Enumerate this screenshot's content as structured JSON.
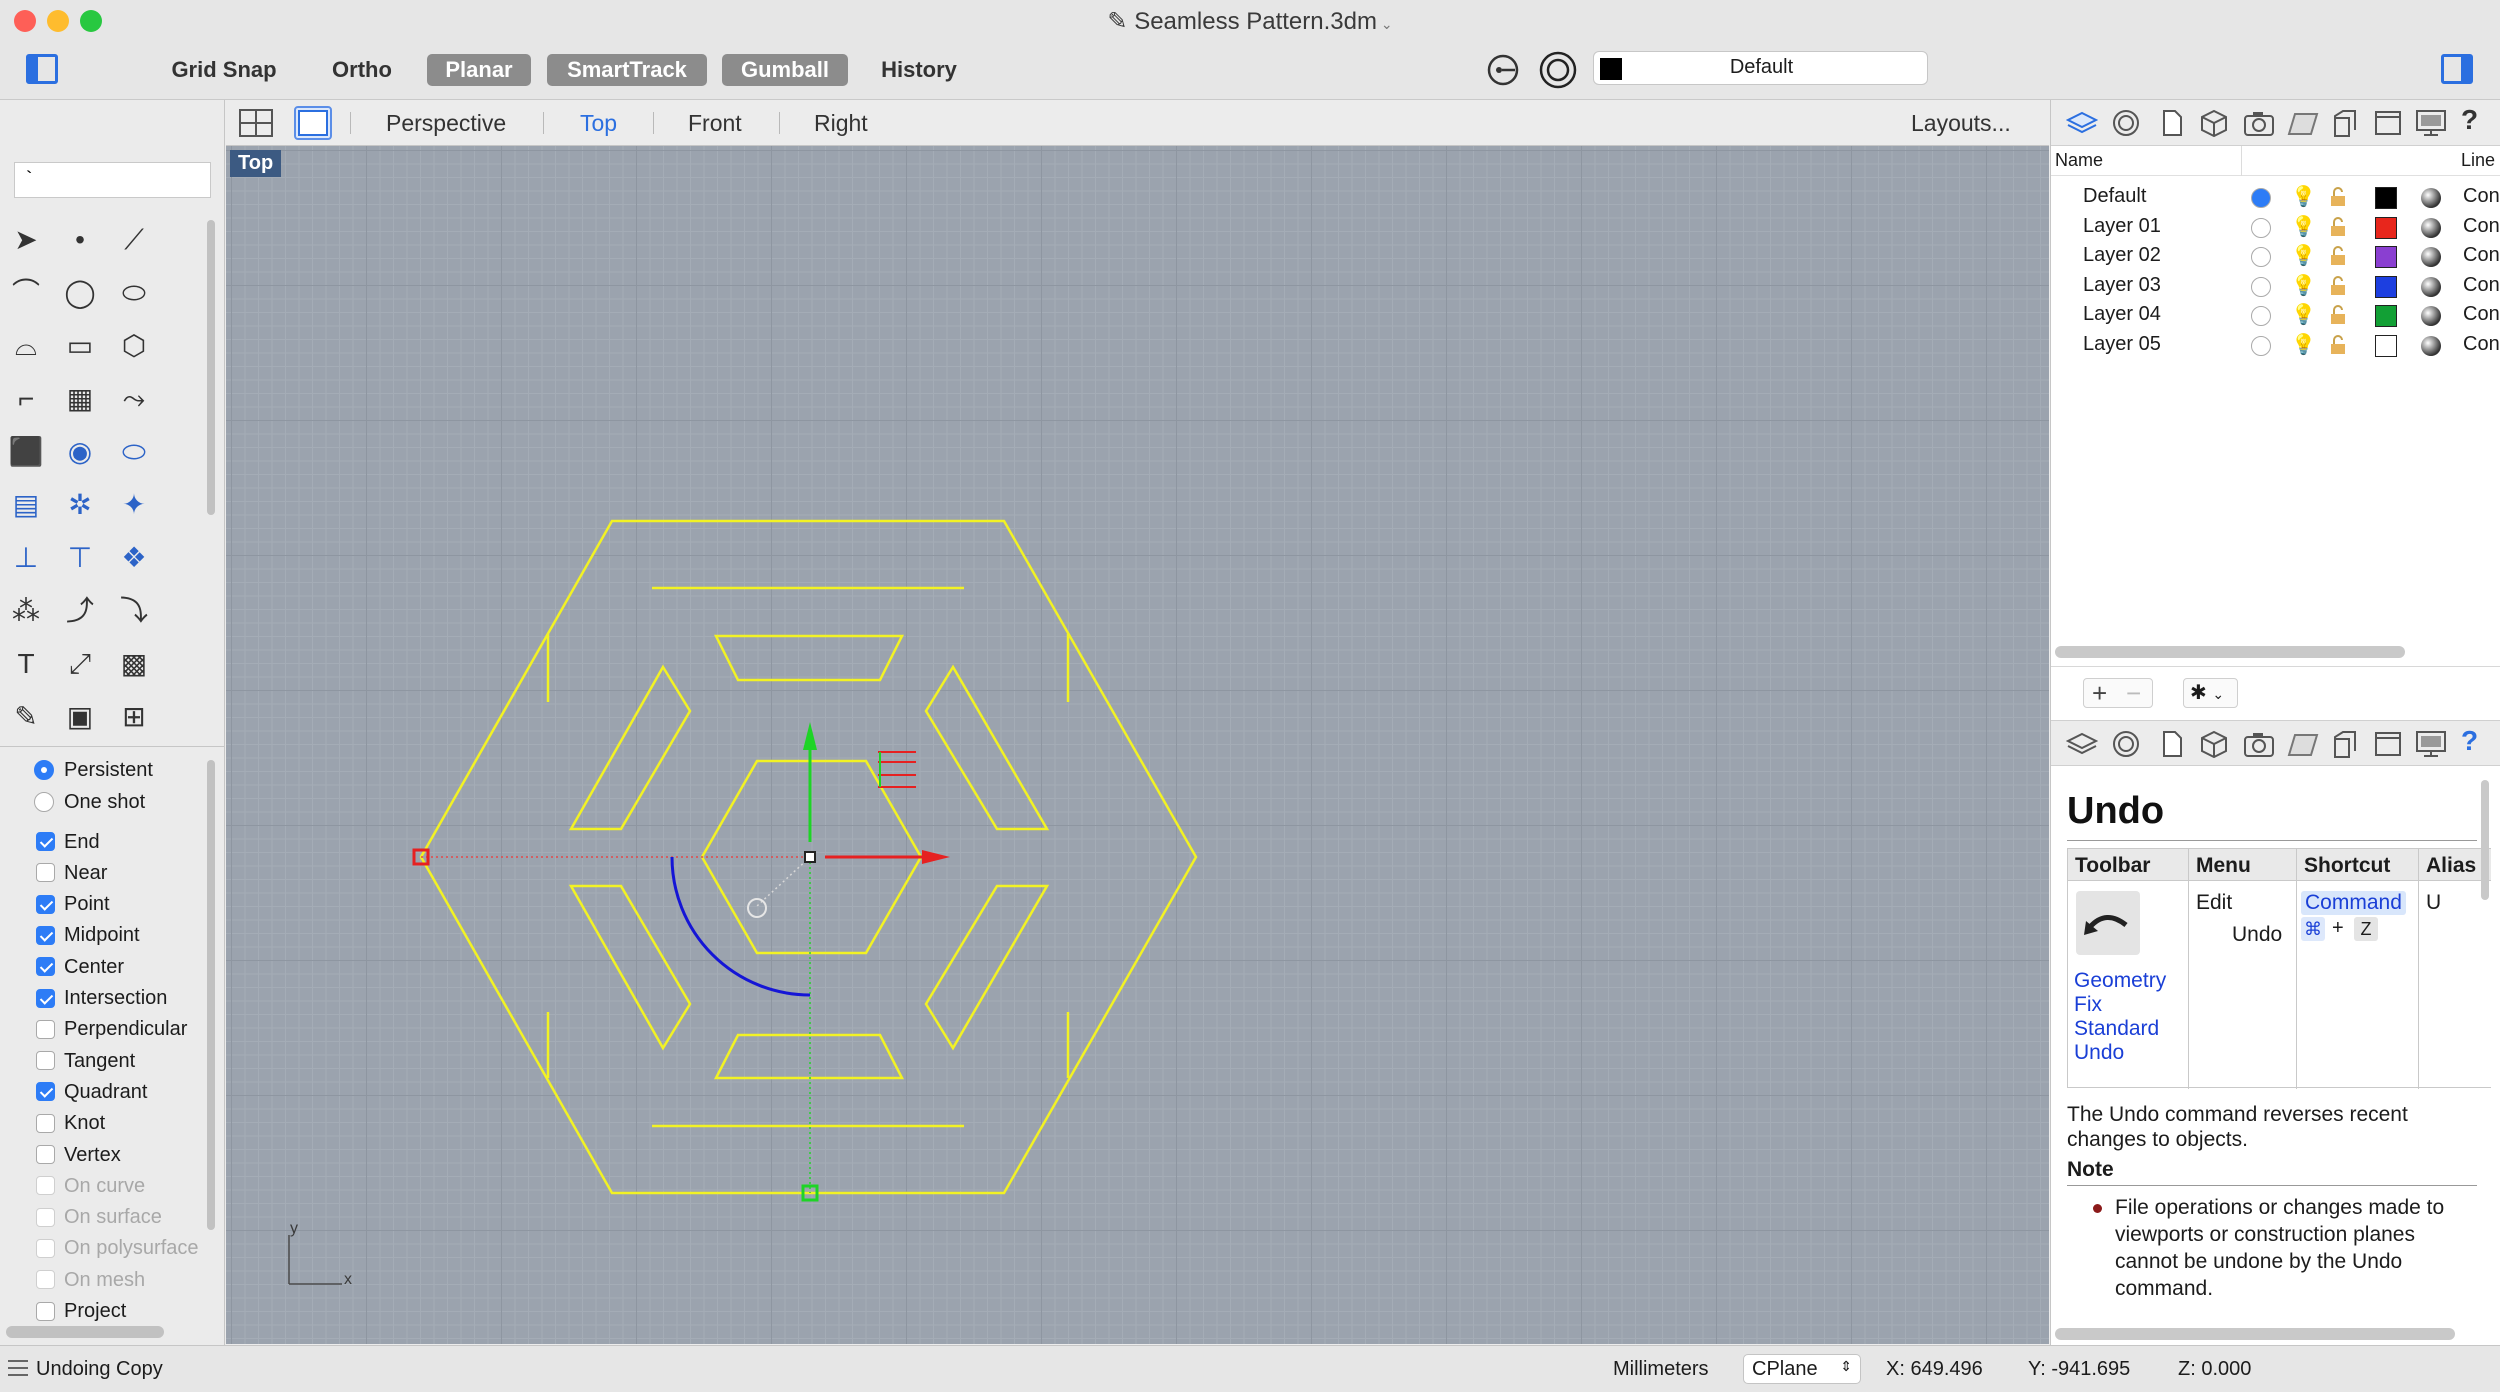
{
  "window": {
    "title": "Seamless Pattern.3dm"
  },
  "toolbar": {
    "buttons": [
      {
        "label": "Grid Snap",
        "on": false
      },
      {
        "label": "Ortho",
        "on": false
      },
      {
        "label": "Planar",
        "on": true
      },
      {
        "label": "SmartTrack",
        "on": true
      },
      {
        "label": "Gumball",
        "on": true
      },
      {
        "label": "History",
        "on": false
      }
    ],
    "layer_select": "Default"
  },
  "command": {
    "input_value": "`"
  },
  "osnap": {
    "modes": [
      "Persistent",
      "One shot"
    ],
    "selected_mode": "Persistent",
    "items": [
      {
        "label": "End",
        "checked": true,
        "enabled": true
      },
      {
        "label": "Near",
        "checked": false,
        "enabled": true
      },
      {
        "label": "Point",
        "checked": true,
        "enabled": true
      },
      {
        "label": "Midpoint",
        "checked": true,
        "enabled": true
      },
      {
        "label": "Center",
        "checked": true,
        "enabled": true
      },
      {
        "label": "Intersection",
        "checked": true,
        "enabled": true
      },
      {
        "label": "Perpendicular",
        "checked": false,
        "enabled": true
      },
      {
        "label": "Tangent",
        "checked": false,
        "enabled": true
      },
      {
        "label": "Quadrant",
        "checked": true,
        "enabled": true
      },
      {
        "label": "Knot",
        "checked": false,
        "enabled": true
      },
      {
        "label": "Vertex",
        "checked": false,
        "enabled": true
      },
      {
        "label": "On curve",
        "checked": false,
        "enabled": false
      },
      {
        "label": "On surface",
        "checked": false,
        "enabled": false
      },
      {
        "label": "On polysurface",
        "checked": false,
        "enabled": false
      },
      {
        "label": "On mesh",
        "checked": false,
        "enabled": false
      },
      {
        "label": "Project",
        "checked": false,
        "enabled": true
      }
    ]
  },
  "viewport_tabs": {
    "tabs": [
      "Perspective",
      "Top",
      "Front",
      "Right"
    ],
    "active": "Top",
    "layouts": "Layouts..."
  },
  "viewport": {
    "label": "Top",
    "axis_x": "x",
    "axis_y": "y"
  },
  "layers": {
    "header_name": "Name",
    "header_linetype": "Line",
    "rows": [
      {
        "name": "Default",
        "current": true,
        "color": "#000000",
        "linetype": "Con"
      },
      {
        "name": "Layer 01",
        "current": false,
        "color": "#e8261c",
        "linetype": "Con"
      },
      {
        "name": "Layer 02",
        "current": false,
        "color": "#8a3fd1",
        "linetype": "Con"
      },
      {
        "name": "Layer 03",
        "current": false,
        "color": "#1d3fe0",
        "linetype": "Con"
      },
      {
        "name": "Layer 04",
        "current": false,
        "color": "#12a035",
        "linetype": "Con"
      },
      {
        "name": "Layer 05",
        "current": false,
        "color": "#ffffff",
        "linetype": "Con"
      }
    ]
  },
  "help": {
    "title": "Undo",
    "headers": [
      "Toolbar",
      "Menu",
      "Shortcut",
      "Alias"
    ],
    "toolbar_links": [
      "Geometry",
      "Fix",
      "Standard",
      "Undo"
    ],
    "menu": [
      "Edit",
      "Undo"
    ],
    "shortcut": {
      "label": "Command",
      "keys": [
        "⌘",
        "+",
        "Z"
      ]
    },
    "alias": "U",
    "description": "The Undo command reverses recent changes to objects.",
    "note_heading": "Note",
    "note_text": "File operations or changes made to viewports or construction planes cannot be undone by the Undo command."
  },
  "status": {
    "message": "Undoing Copy",
    "units": "Millimeters",
    "cplane": "CPlane",
    "x": "X: 649.496",
    "y": "Y: -941.695",
    "z": "Z: 0.000"
  },
  "colors": {
    "accent": "#2d7cf6",
    "curve": "#f2f224",
    "gumball_x": "#e62121",
    "gumball_y": "#1ed426",
    "arc": "#1515d6"
  }
}
